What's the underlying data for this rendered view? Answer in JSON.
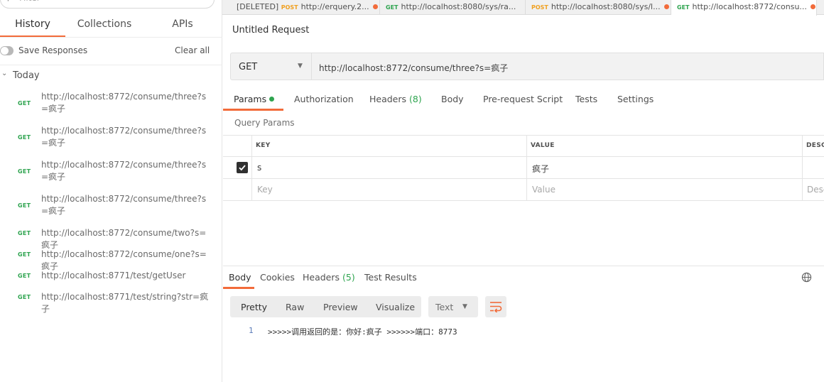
{
  "sidebar": {
    "filter_placeholder": "Filter",
    "tabs": [
      {
        "label": "History"
      },
      {
        "label": "Collections"
      },
      {
        "label": "APIs"
      }
    ],
    "save_responses_label": "Save Responses",
    "clear_all_label": "Clear all",
    "group_label": "Today",
    "history": [
      {
        "method": "GET",
        "url": "http://localhost:8772/consume/three?s=疯子"
      },
      {
        "method": "GET",
        "url": "http://localhost:8772/consume/three?s=疯子"
      },
      {
        "method": "GET",
        "url": "http://localhost:8772/consume/three?s=疯子"
      },
      {
        "method": "GET",
        "url": "http://localhost:8772/consume/three?s=疯子"
      },
      {
        "method": "GET",
        "url": "http://localhost:8772/consume/two?s=疯子"
      },
      {
        "method": "GET",
        "url": "http://localhost:8772/consume/one?s=疯子"
      },
      {
        "method": "GET",
        "url": "http://localhost:8771/test/getUser"
      },
      {
        "method": "GET",
        "url": "http://localhost:8771/test/string?str=疯子"
      }
    ]
  },
  "request_tabs": [
    {
      "prefix": "[DELETED]",
      "method": "POST",
      "title": "http://erquery.2..."
    },
    {
      "prefix": "",
      "method": "GET",
      "title": "http://localhost:8080/sys/ra..."
    },
    {
      "prefix": "",
      "method": "POST",
      "title": "http://localhost:8080/sys/l..."
    },
    {
      "prefix": "",
      "method": "GET",
      "title": "http://localhost:8772/consu..."
    }
  ],
  "request": {
    "title": "Untitled Request",
    "method": "GET",
    "url": "http://localhost:8772/consume/three?s=疯子",
    "tabs": {
      "params": "Params",
      "authorization": "Authorization",
      "headers": "Headers",
      "headers_count": "(8)",
      "body": "Body",
      "prerequest": "Pre-request Script",
      "tests": "Tests",
      "settings": "Settings"
    },
    "query_params_label": "Query Params",
    "table": {
      "col_key": "KEY",
      "col_value": "VALUE",
      "col_desc": "DESC",
      "row_key": "s",
      "row_value": "疯子",
      "row_checked": true,
      "ph_key": "Key",
      "ph_value": "Value",
      "ph_desc": "Desc"
    }
  },
  "response": {
    "tabs": {
      "body": "Body",
      "cookies": "Cookies",
      "headers": "Headers",
      "headers_count": "(5)",
      "test_results": "Test Results"
    },
    "formats": {
      "pretty": "Pretty",
      "raw": "Raw",
      "preview": "Preview",
      "visualize": "Visualize"
    },
    "type": "Text",
    "line_number": "1",
    "body_text": ">>>>>调用返回的是：你好:疯子 >>>>>>端口：8773"
  },
  "colors": {
    "accent": "#f26b3a",
    "get": "#2ea44f",
    "post": "#f0a020"
  }
}
